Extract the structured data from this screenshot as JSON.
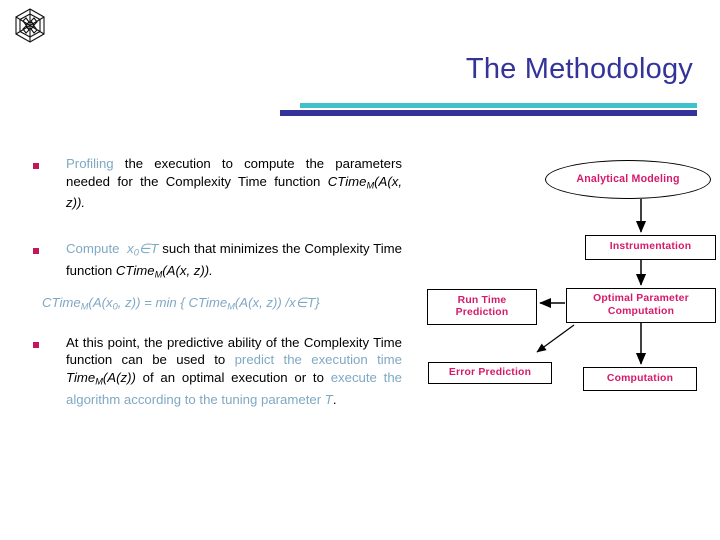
{
  "slide": {
    "logo_name": "institution-hex-logo",
    "title": "The Methodology",
    "accent_teal": "#3fc3c9",
    "accent_navy": "#333399",
    "accent_magenta": "#d61a6b",
    "accent_lightblue": "#7fa8c4"
  },
  "bullets": [
    {
      "id": "bullet-profiling",
      "segments": [
        {
          "text": "Profiling",
          "style": "blue"
        },
        {
          "text": " the execution to compute the parameters needed for the Complexity Time function ",
          "style": "plain"
        },
        {
          "text": "CTime",
          "style": "italic"
        },
        {
          "text": "M",
          "style": "italic-sub"
        },
        {
          "text": "(A(x, z)).",
          "style": "italic"
        }
      ]
    },
    {
      "id": "bullet-compute",
      "segments": [
        {
          "text": "Compute",
          "style": "blue"
        },
        {
          "text": " ",
          "style": "blue"
        },
        {
          "text": "x",
          "style": "blue-italic"
        },
        {
          "text": "0",
          "style": "blue-italic-sub"
        },
        {
          "text": "∈T",
          "style": "blue-italic"
        },
        {
          "text": " such that minimizes the Complexity Time function ",
          "style": "plain"
        },
        {
          "text": "CTime",
          "style": "italic"
        },
        {
          "text": "M",
          "style": "italic-sub"
        },
        {
          "text": "(A(x, z)).",
          "style": "italic"
        }
      ]
    },
    {
      "id": "bullet-prediction",
      "segments": [
        {
          "text": "At this point, the predictive ability of the Complexity Time function can be used to ",
          "style": "plain"
        },
        {
          "text": "predict the execution time ",
          "style": "blue"
        },
        {
          "text": "Time",
          "style": "italic"
        },
        {
          "text": "M",
          "style": "italic-sub"
        },
        {
          "text": "(A(z))",
          "style": "italic"
        },
        {
          "text": " of an optimal execution or to ",
          "style": "plain"
        },
        {
          "text": "execute the algorithm according to the tuning parameter ",
          "style": "blue"
        },
        {
          "text": "T",
          "style": "blue-italic"
        },
        {
          "text": ".",
          "style": "plain"
        }
      ]
    }
  ],
  "formula": {
    "id": "formula-ctime-min",
    "text": "CTimeₘ(A(x₀, z)) = min { CTimeₘ(A(x, z)) /x∈T}",
    "parts": {
      "lhs_fn": "CTime",
      "lhs_sub": "M",
      "lhs_args": "(A(x",
      "lhs_arg_sub": "0",
      "lhs_tail": ", z)) = min { ",
      "rhs_fn": "CTime",
      "rhs_sub": "M",
      "rhs_tail": "(A(x, z)) /x∈T}"
    }
  },
  "diagram": {
    "nodes": [
      {
        "id": "node-analytical-modeling",
        "name": "analytical-modeling-node",
        "shape": "ellipse",
        "lines": [
          "Analytical Modeling"
        ]
      },
      {
        "id": "node-instrumentation",
        "name": "instrumentation-node",
        "shape": "box",
        "lines": [
          "Instrumentation"
        ]
      },
      {
        "id": "node-run-time-prediction",
        "name": "run-time-prediction-node",
        "shape": "box",
        "lines": [
          "Run Time",
          "Prediction"
        ]
      },
      {
        "id": "node-optimal-parameter-computation",
        "name": "optimal-parameter-computation-node",
        "shape": "box",
        "lines": [
          "Optimal Parameter",
          "Computation"
        ]
      },
      {
        "id": "node-error-prediction",
        "name": "error-prediction-node",
        "shape": "box",
        "lines": [
          "Error Prediction"
        ]
      },
      {
        "id": "node-computation",
        "name": "computation-node",
        "shape": "box",
        "lines": [
          "Computation"
        ]
      }
    ],
    "edges": [
      {
        "id": "edge-modeling-to-instrumentation",
        "from": "Analytical Modeling",
        "to": "Instrumentation"
      },
      {
        "id": "edge-instrumentation-to-optimal",
        "from": "Instrumentation",
        "to": "Optimal Parameter Computation"
      },
      {
        "id": "edge-optimal-to-runtime",
        "from": "Optimal Parameter Computation",
        "to": "Run Time Prediction"
      },
      {
        "id": "edge-optimal-to-error",
        "from": "Optimal Parameter Computation",
        "to": "Error Prediction"
      },
      {
        "id": "edge-optimal-to-computation",
        "from": "Optimal Parameter Computation",
        "to": "Computation"
      }
    ]
  }
}
